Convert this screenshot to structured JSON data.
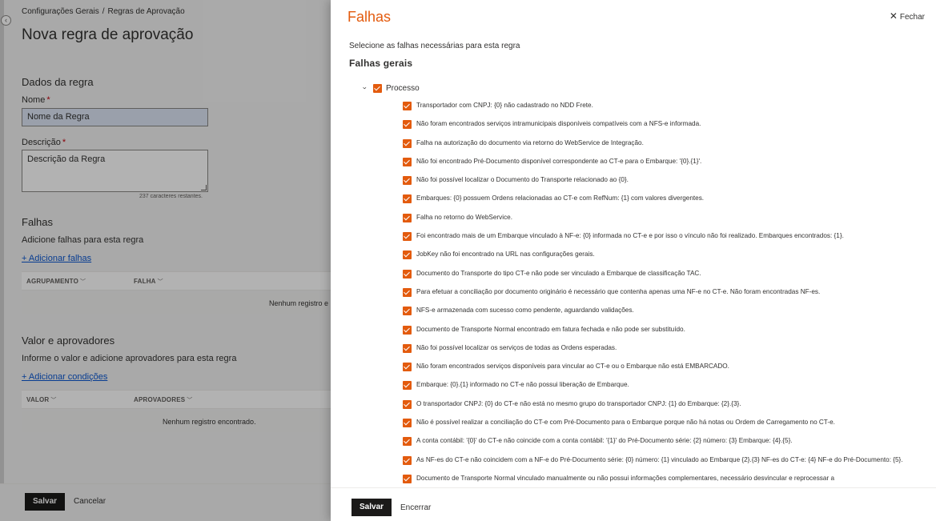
{
  "left": {
    "breadcrumb": [
      "Configurações Gerais",
      "Regras de Aprovação"
    ],
    "breadcrumb_sep": "/",
    "title": "Nova regra de aprovação",
    "dados_title": "Dados da regra",
    "nome_label": "Nome",
    "required_mark": "*",
    "nome_value": "Nome da Regra",
    "descricao_label": "Descrição",
    "descricao_value": "Descrição da Regra",
    "char_count": "237 caracteres restantes.",
    "falhas_title": "Falhas",
    "falhas_desc": "Adicione falhas para esta regra",
    "add_falhas_link": "+ Adicionar falhas",
    "falhas_table": {
      "columns": [
        "AGRUPAMENTO",
        "FALHA"
      ],
      "empty": "Nenhum registro e"
    },
    "valor_title": "Valor e aprovadores",
    "valor_desc": "Informe o valor e adicione aprovadores para esta regra",
    "add_condicoes_link": "+ Adicionar condições",
    "valor_table": {
      "columns": [
        "VALOR",
        "APROVADORES"
      ],
      "empty": "Nenhum registro encontrado."
    },
    "footer": {
      "save": "Salvar",
      "cancel": "Cancelar"
    }
  },
  "panel": {
    "title": "Falhas",
    "close": "Fechar",
    "description": "Selecione as falhas necessárias para esta regra",
    "subtitle": "Falhas gerais",
    "group": {
      "label": "Processo",
      "checked": true
    },
    "items": [
      "Transportador com CNPJ: {0} não cadastrado no NDD Frete.",
      "Não foram encontrados serviços intramunicipais disponíveis compatíveis com a NFS-e informada.",
      "Falha na autorização do documento via retorno do WebService de Integração.",
      "Não foi encontrado Pré-Documento disponível correspondente ao CT-e para o Embarque: '{0}.{1}'.",
      "Não foi possível localizar o Documento do Transporte relacionado ao {0}.",
      "Embarques: {0} possuem Ordens relacionadas ao CT-e com RefNum: {1} com valores divergentes.",
      "Falha no retorno do WebService.",
      "Foi encontrado mais de um Embarque vinculado à NF-e: {0} informada no CT-e e por isso o vínculo não foi realizado. Embarques encontrados: {1}.",
      "JobKey não foi encontrado na URL nas configurações gerais.",
      "Documento do Transporte do tipo CT-e não pode ser vinculado a Embarque de classificação TAC.",
      "Para efetuar a conciliação por documento originário é necessário que contenha apenas uma NF-e no CT-e. Não foram encontradas NF-es.",
      "NFS-e armazenada com sucesso como pendente, aguardando validações.",
      "Documento de Transporte Normal encontrado em fatura fechada e não pode ser substituído.",
      "Não foi possível localizar os serviços de todas as Ordens esperadas.",
      "Não foram encontrados serviços disponíveis para vincular ao CT-e ou o Embarque não está EMBARCADO.",
      "Embarque: {0}.{1} informado no CT-e não possui liberação de Embarque.",
      "O transportador CNPJ: {0} do CT-e não está no mesmo grupo do transportador CNPJ: {1} do Embarque: {2}.{3}.",
      "Não é possível realizar a conciliação do CT-e com Pré-Documento para o Embarque porque não há notas ou Ordem de Carregamento no CT-e.",
      "A conta contábil: '{0}' do CT-e não coincide com a conta contábil: '{1}' do Pré-Documento série: {2} número: {3} Embarque: {4}.{5}.",
      "As NF-es do CT-e não coincidem com a NF-e do Pré-Documento série: {0} número: {1} vinculado ao Embarque {2}.{3} NF-es do CT-e: {4} NF-e do Pré-Documento: {5}.",
      "Documento de Transporte Normal vinculado manualmente ou não possui informações complementares, necessário desvincular e reprocessar a"
    ],
    "footer": {
      "save": "Salvar",
      "close": "Encerrar"
    }
  },
  "colors": {
    "accent": "#e35b0e",
    "link": "#0b57d0",
    "dark_button": "#1b1a19"
  },
  "icons": {
    "close": "close-icon",
    "expand": "chevron-down-icon",
    "check": "checkmark-icon",
    "sort": "chevron-down-icon"
  }
}
